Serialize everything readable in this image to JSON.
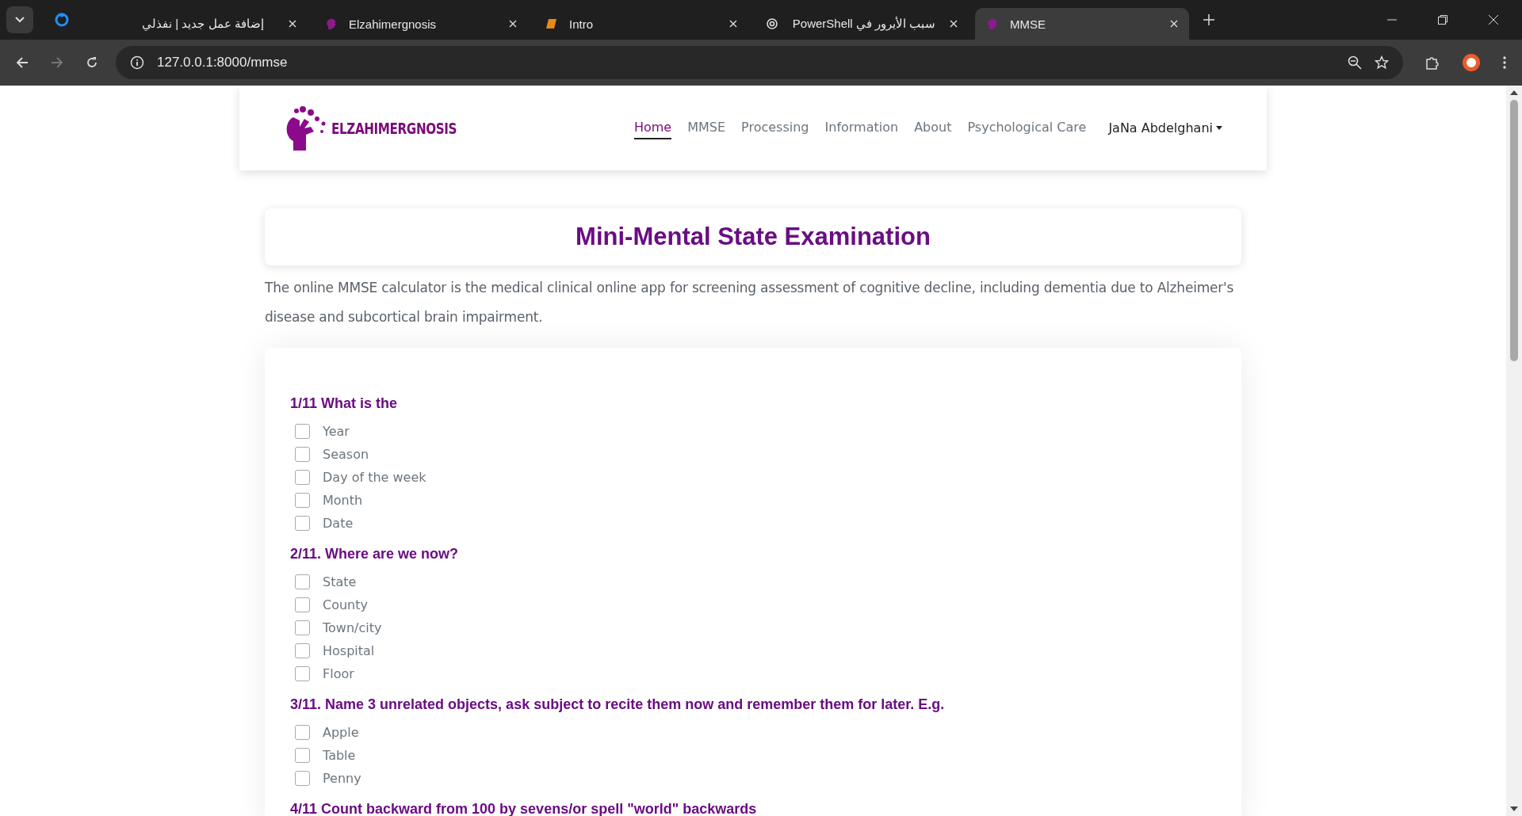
{
  "browser": {
    "tabs": [
      {
        "kind": "site",
        "title": "إضافة عمل جديد | نفذلي",
        "selected": false
      },
      {
        "kind": "brain",
        "title": "Elzahimergnosis",
        "selected": false
      },
      {
        "kind": "book",
        "title": "Intro",
        "selected": false
      },
      {
        "kind": "spiral",
        "title": "سبب الأيرور في PowerShell",
        "selected": false
      },
      {
        "kind": "brain",
        "title": "MMSE",
        "selected": true
      }
    ],
    "url": "127.0.0.1:8000/mmse"
  },
  "nav": {
    "brand": "ELZAHIMERGNOSIS",
    "links": [
      {
        "label": "Home",
        "selected": true
      },
      {
        "label": "MMSE",
        "selected": false
      },
      {
        "label": "Processing",
        "selected": false
      },
      {
        "label": "Information",
        "selected": false
      },
      {
        "label": "About",
        "selected": false
      },
      {
        "label": "Psychological Care",
        "selected": false
      }
    ],
    "user": "JaNa Abdelghani"
  },
  "title": "Mini-Mental State Examination",
  "description": "The online MMSE calculator is the medical clinical online app for screening assessment of cognitive decline, including dementia due to Alzheimer's disease and subcortical brain impairment.",
  "questions": [
    {
      "title": "1/11 What is the",
      "options": [
        {
          "label": "Year",
          "checked": false
        },
        {
          "label": "Season",
          "checked": false
        },
        {
          "label": "Day of the week",
          "checked": false
        },
        {
          "label": "Month",
          "checked": false
        },
        {
          "label": "Date",
          "checked": false
        }
      ]
    },
    {
      "title": "2/11. Where are we now?",
      "options": [
        {
          "label": "State",
          "checked": false
        },
        {
          "label": "County",
          "checked": false
        },
        {
          "label": "Town/city",
          "checked": false
        },
        {
          "label": "Hospital",
          "checked": false
        },
        {
          "label": "Floor",
          "checked": false
        }
      ]
    },
    {
      "title": "3/11. Name 3 unrelated objects, ask subject to recite them now and remember them for later. E.g.",
      "options": [
        {
          "label": "Apple",
          "checked": false
        },
        {
          "label": "Table",
          "checked": false
        },
        {
          "label": "Penny",
          "checked": false
        }
      ]
    },
    {
      "title": "4/11 Count backward from 100 by sevens/or spell \"world\" backwards"
    }
  ]
}
